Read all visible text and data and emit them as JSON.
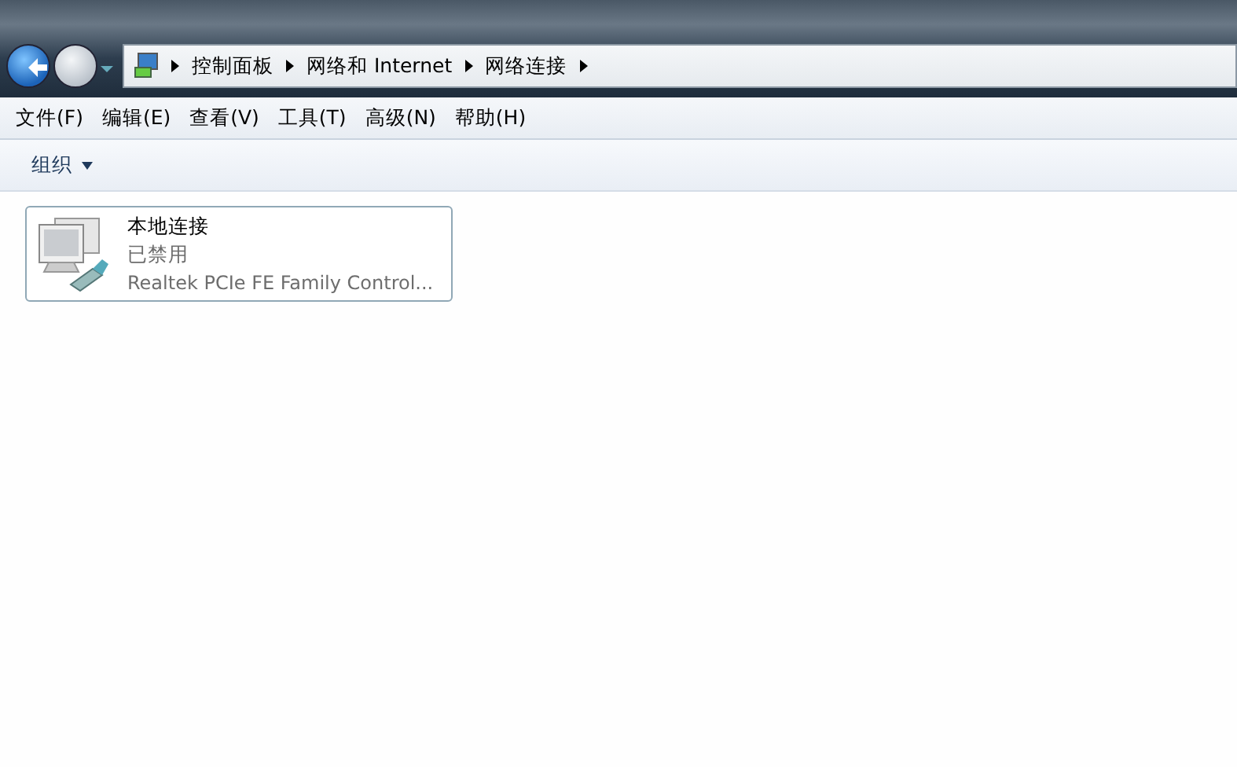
{
  "breadcrumb": [
    "控制面板",
    "网络和 Internet",
    "网络连接"
  ],
  "menu": [
    "文件(F)",
    "编辑(E)",
    "查看(V)",
    "工具(T)",
    "高级(N)",
    "帮助(H)"
  ],
  "toolbar": {
    "organize": "组织"
  },
  "connections": [
    {
      "name": "本地连接",
      "status": "已禁用",
      "device": "Realtek PCIe FE Family Control..."
    }
  ]
}
